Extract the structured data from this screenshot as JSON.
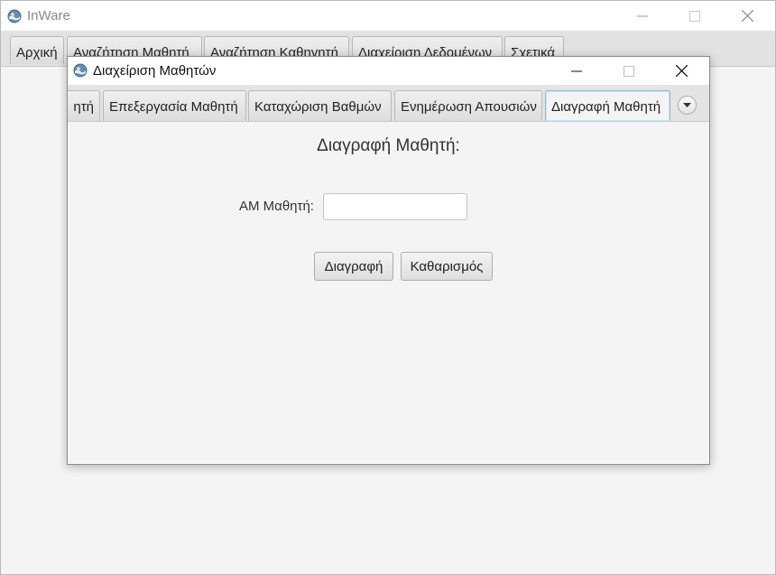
{
  "main_window": {
    "title": "InWare",
    "tabs": [
      "Αρχική",
      "Αναζήτηση Μαθητή",
      "Αναζήτηση Καθηγητή",
      "Διαχείριση Δεδομένων",
      "Σχετικά"
    ]
  },
  "dialog": {
    "title": "Διαχείριση Μαθητών",
    "tabs": [
      "ητή",
      "Επεξεργασία Μαθητή",
      "Καταχώριση Βαθμών",
      "Ενημέρωση Απουσιών",
      "Διαγραφή Μαθητή"
    ],
    "active_tab": "Διαγραφή Μαθητή",
    "form": {
      "heading": "Διαγραφή Μαθητή:",
      "am_label": "ΑΜ Μαθητή:",
      "am_value": "",
      "am_placeholder": "",
      "delete_label": "Διαγραφή",
      "clear_label": "Καθαρισμός"
    }
  },
  "icons": {
    "app": "app-globe-icon",
    "minimize": "minimize-icon",
    "maximize": "maximize-icon",
    "close": "close-icon",
    "tabs_overflow": "chevron-down-icon"
  },
  "colors": {
    "active_tab_border": "#8db8d8",
    "window_bg": "#f4f4f4",
    "titlebar_bg": "#ffffff"
  }
}
